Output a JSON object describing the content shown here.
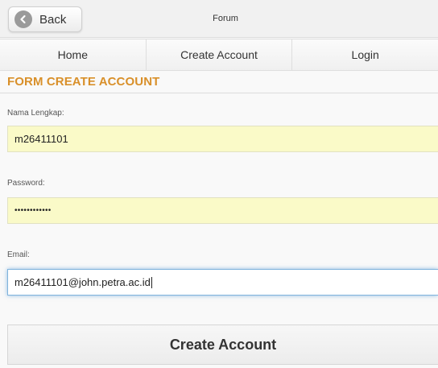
{
  "header": {
    "back_label": "Back",
    "title": "Forum"
  },
  "navbar": {
    "items": [
      {
        "label": "Home"
      },
      {
        "label": "Create Account"
      },
      {
        "label": "Login"
      }
    ]
  },
  "form": {
    "heading": "FORM CREATE ACCOUNT",
    "name": {
      "label": "Nama Lengkap:",
      "value": "m26411101"
    },
    "password": {
      "label": "Password:",
      "value": "••••••••••••"
    },
    "email": {
      "label": "Email:",
      "value": "m26411101@john.petra.ac.id"
    },
    "submit_label": "Create Account"
  },
  "colors": {
    "heading": "#d9902a",
    "autofill": "#fafac8",
    "focus_glow": "#7fb3dc"
  }
}
